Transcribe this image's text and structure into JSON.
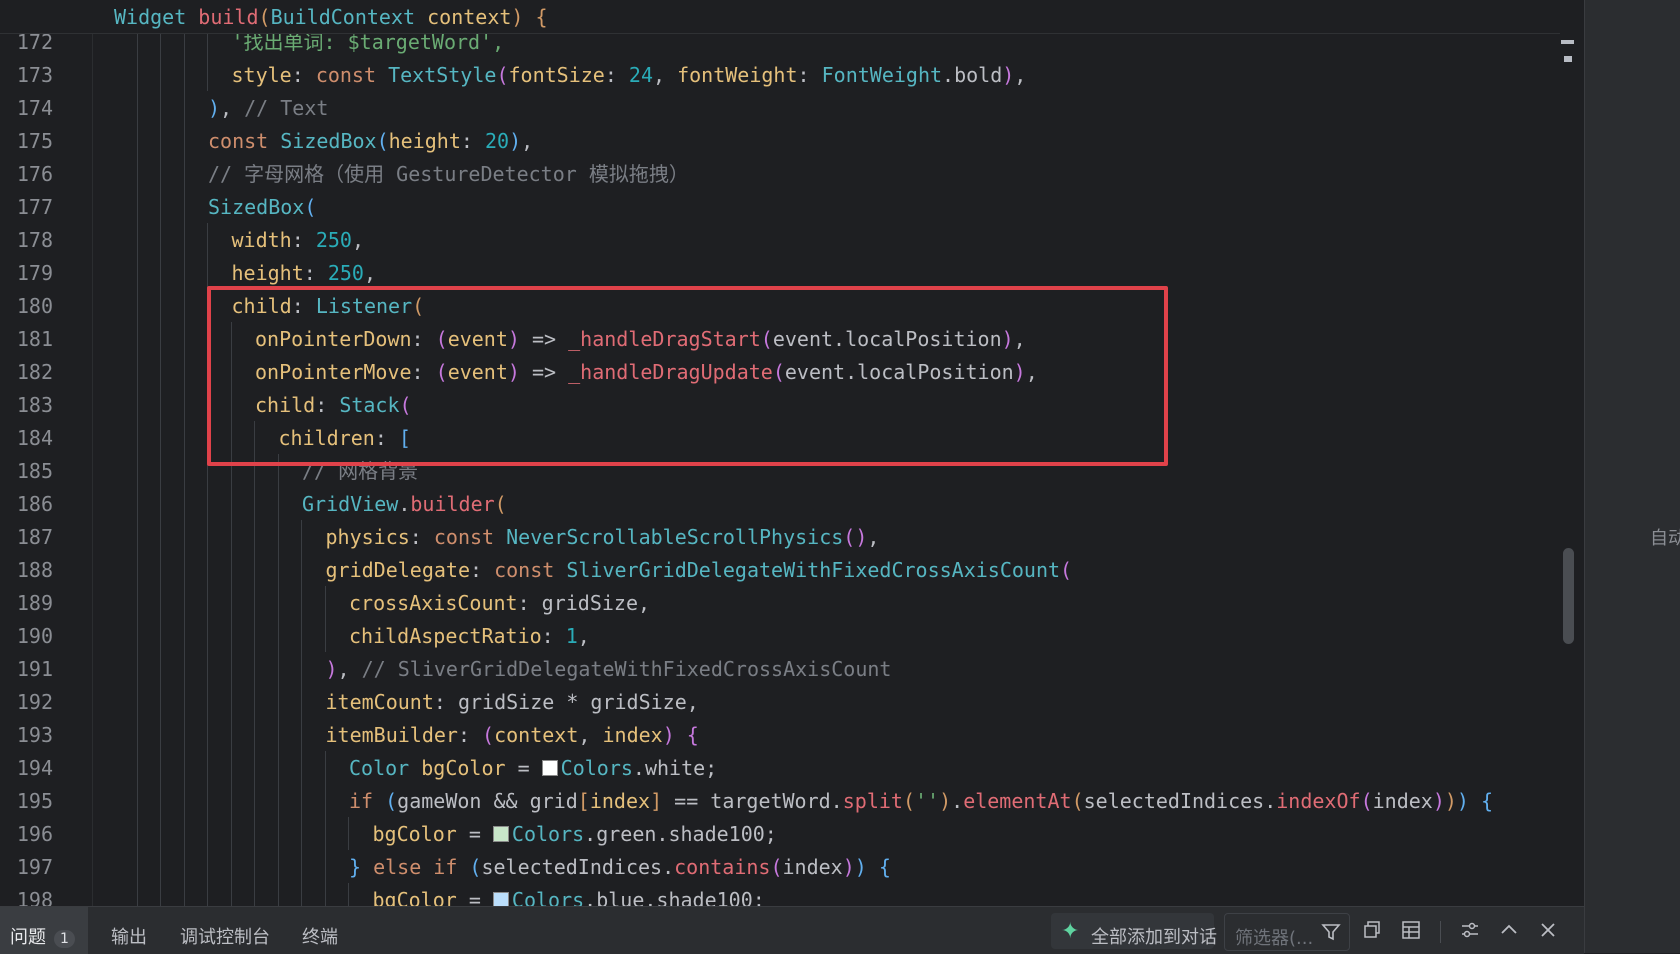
{
  "editor": {
    "sticky_header": "Widget build(BuildContext context) {",
    "lines": [
      {
        "n": "172",
        "indent": 5,
        "tokens": [
          [
            "t-str",
            "'找出单词: $targetWord',"
          ]
        ]
      },
      {
        "n": "173",
        "indent": 5,
        "tokens": [
          [
            "t-param",
            "style"
          ],
          [
            "t-op",
            ": "
          ],
          [
            "t-kw",
            "const "
          ],
          [
            "t-type",
            "TextStyle"
          ],
          [
            "t-br2",
            "("
          ],
          [
            "t-param",
            "fontSize"
          ],
          [
            "t-op",
            ": "
          ],
          [
            "t-num",
            "24"
          ],
          [
            "t-op",
            ", "
          ],
          [
            "t-param",
            "fontWeight"
          ],
          [
            "t-op",
            ": "
          ],
          [
            "t-type",
            "FontWeight"
          ],
          [
            "t-op",
            ".bold"
          ],
          [
            "t-br2",
            ")"
          ],
          [
            "t-op",
            ","
          ]
        ]
      },
      {
        "n": "174",
        "indent": 4,
        "tokens": [
          [
            "t-br3",
            ")"
          ],
          [
            "t-op",
            ", "
          ],
          [
            "t-cm",
            "// Text"
          ]
        ]
      },
      {
        "n": "175",
        "indent": 4,
        "tokens": [
          [
            "t-kw",
            "const "
          ],
          [
            "t-type",
            "SizedBox"
          ],
          [
            "t-br3",
            "("
          ],
          [
            "t-param",
            "height"
          ],
          [
            "t-op",
            ": "
          ],
          [
            "t-num",
            "20"
          ],
          [
            "t-br3",
            ")"
          ],
          [
            "t-op",
            ","
          ]
        ]
      },
      {
        "n": "176",
        "indent": 4,
        "tokens": [
          [
            "t-cm",
            "// 字母网格（使用 GestureDetector 模拟拖拽）"
          ]
        ]
      },
      {
        "n": "177",
        "indent": 4,
        "tokens": [
          [
            "t-type",
            "SizedBox"
          ],
          [
            "t-br3",
            "("
          ]
        ]
      },
      {
        "n": "178",
        "indent": 5,
        "tokens": [
          [
            "t-param",
            "width"
          ],
          [
            "t-op",
            ": "
          ],
          [
            "t-num",
            "250"
          ],
          [
            "t-op",
            ","
          ]
        ]
      },
      {
        "n": "179",
        "indent": 5,
        "tokens": [
          [
            "t-param",
            "height"
          ],
          [
            "t-op",
            ": "
          ],
          [
            "t-num",
            "250"
          ],
          [
            "t-op",
            ","
          ]
        ]
      },
      {
        "n": "180",
        "indent": 5,
        "tokens": [
          [
            "t-param",
            "child"
          ],
          [
            "t-op",
            ": "
          ],
          [
            "t-type",
            "Listener"
          ],
          [
            "t-br1",
            "("
          ]
        ]
      },
      {
        "n": "181",
        "indent": 6,
        "tokens": [
          [
            "t-param",
            "onPointerDown"
          ],
          [
            "t-op",
            ": "
          ],
          [
            "t-br2",
            "("
          ],
          [
            "t-param",
            "event"
          ],
          [
            "t-br2",
            ")"
          ],
          [
            "t-op",
            " => "
          ],
          [
            "t-fn",
            "_handleDragStart"
          ],
          [
            "t-br2",
            "("
          ],
          [
            "t-op",
            "event.localPosition"
          ],
          [
            "t-br2",
            ")"
          ],
          [
            "t-op",
            ","
          ]
        ]
      },
      {
        "n": "182",
        "indent": 6,
        "tokens": [
          [
            "t-param",
            "onPointerMove"
          ],
          [
            "t-op",
            ": "
          ],
          [
            "t-br2",
            "("
          ],
          [
            "t-param",
            "event"
          ],
          [
            "t-br2",
            ")"
          ],
          [
            "t-op",
            " => "
          ],
          [
            "t-fn",
            "_handleDragUpdate"
          ],
          [
            "t-br2",
            "("
          ],
          [
            "t-op",
            "event.localPosition"
          ],
          [
            "t-br2",
            ")"
          ],
          [
            "t-op",
            ","
          ]
        ]
      },
      {
        "n": "183",
        "indent": 6,
        "tokens": [
          [
            "t-param",
            "child"
          ],
          [
            "t-op",
            ": "
          ],
          [
            "t-type",
            "Stack"
          ],
          [
            "t-br2",
            "("
          ]
        ]
      },
      {
        "n": "184",
        "indent": 7,
        "tokens": [
          [
            "t-param",
            "children"
          ],
          [
            "t-op",
            ": "
          ],
          [
            "t-br3",
            "["
          ]
        ]
      },
      {
        "n": "185",
        "indent": 8,
        "tokens": [
          [
            "t-cm",
            "// 网格背景"
          ]
        ]
      },
      {
        "n": "186",
        "indent": 8,
        "tokens": [
          [
            "t-type",
            "GridView"
          ],
          [
            "t-op",
            "."
          ],
          [
            "t-fn",
            "builder"
          ],
          [
            "t-br1",
            "("
          ]
        ]
      },
      {
        "n": "187",
        "indent": 9,
        "tokens": [
          [
            "t-param",
            "physics"
          ],
          [
            "t-op",
            ": "
          ],
          [
            "t-kw",
            "const "
          ],
          [
            "t-type",
            "NeverScrollableScrollPhysics"
          ],
          [
            "t-br2",
            "()"
          ],
          [
            "t-op",
            ","
          ]
        ]
      },
      {
        "n": "188",
        "indent": 9,
        "tokens": [
          [
            "t-param",
            "gridDelegate"
          ],
          [
            "t-op",
            ": "
          ],
          [
            "t-kw",
            "const "
          ],
          [
            "t-type",
            "SliverGridDelegateWithFixedCrossAxisCount"
          ],
          [
            "t-br2",
            "("
          ]
        ]
      },
      {
        "n": "189",
        "indent": 10,
        "tokens": [
          [
            "t-param",
            "crossAxisCount"
          ],
          [
            "t-op",
            ": gridSize,"
          ]
        ]
      },
      {
        "n": "190",
        "indent": 10,
        "tokens": [
          [
            "t-param",
            "childAspectRatio"
          ],
          [
            "t-op",
            ": "
          ],
          [
            "t-num",
            "1"
          ],
          [
            "t-op",
            ","
          ]
        ]
      },
      {
        "n": "191",
        "indent": 9,
        "tokens": [
          [
            "t-br2",
            ")"
          ],
          [
            "t-op",
            ", "
          ],
          [
            "t-cm",
            "// SliverGridDelegateWithFixedCrossAxisCount"
          ]
        ]
      },
      {
        "n": "192",
        "indent": 9,
        "tokens": [
          [
            "t-param",
            "itemCount"
          ],
          [
            "t-op",
            ": gridSize * gridSize,"
          ]
        ]
      },
      {
        "n": "193",
        "indent": 9,
        "tokens": [
          [
            "t-param",
            "itemBuilder"
          ],
          [
            "t-op",
            ": "
          ],
          [
            "t-br2",
            "("
          ],
          [
            "t-param",
            "context"
          ],
          [
            "t-op",
            ", "
          ],
          [
            "t-param",
            "index"
          ],
          [
            "t-br2",
            ")"
          ],
          [
            "t-op",
            " "
          ],
          [
            "t-br2",
            "{"
          ]
        ]
      },
      {
        "n": "194",
        "indent": 10,
        "tokens": [
          [
            "t-type",
            "Color "
          ],
          [
            "t-param",
            "bgColor"
          ],
          [
            "t-op",
            " = "
          ],
          [
            "swatch",
            "#ffffff"
          ],
          [
            "t-type",
            "Colors"
          ],
          [
            "t-op",
            ".white;"
          ]
        ]
      },
      {
        "n": "195",
        "indent": 10,
        "tokens": [
          [
            "t-kw",
            "if "
          ],
          [
            "t-br3",
            "("
          ],
          [
            "t-op",
            "gameWon && grid"
          ],
          [
            "t-br1",
            "["
          ],
          [
            "t-param",
            "index"
          ],
          [
            "t-br1",
            "]"
          ],
          [
            "t-op",
            " == targetWord."
          ],
          [
            "t-fn",
            "split"
          ],
          [
            "t-br1",
            "("
          ],
          [
            "t-str",
            "''"
          ],
          [
            "t-br1",
            ")"
          ],
          [
            "t-op",
            "."
          ],
          [
            "t-fn",
            "elementAt"
          ],
          [
            "t-br1",
            "("
          ],
          [
            "t-op",
            "selectedIndices."
          ],
          [
            "t-fn",
            "indexOf"
          ],
          [
            "t-br2",
            "("
          ],
          [
            "t-op",
            "index"
          ],
          [
            "t-br2",
            ")"
          ],
          [
            "t-br1",
            ")"
          ],
          [
            "t-br3",
            ")"
          ],
          [
            "t-op",
            " "
          ],
          [
            "t-br3",
            "{"
          ]
        ]
      },
      {
        "n": "196",
        "indent": 11,
        "tokens": [
          [
            "t-param",
            "bgColor"
          ],
          [
            "t-op",
            " = "
          ],
          [
            "swatch",
            "#c8e6c9"
          ],
          [
            "t-type",
            "Colors"
          ],
          [
            "t-op",
            ".green.shade100;"
          ]
        ]
      },
      {
        "n": "197",
        "indent": 10,
        "tokens": [
          [
            "t-br3",
            "}"
          ],
          [
            "t-kw",
            " else if "
          ],
          [
            "t-br3",
            "("
          ],
          [
            "t-op",
            "selectedIndices."
          ],
          [
            "t-fn",
            "contains"
          ],
          [
            "t-br2",
            "("
          ],
          [
            "t-op",
            "index"
          ],
          [
            "t-br2",
            ")"
          ],
          [
            "t-br3",
            ")"
          ],
          [
            "t-op",
            " "
          ],
          [
            "t-br3",
            "{"
          ]
        ]
      },
      {
        "n": "198",
        "indent": 11,
        "tokens": [
          [
            "t-param",
            "bgColor"
          ],
          [
            "t-op",
            " = "
          ],
          [
            "swatch",
            "#bbdefb"
          ],
          [
            "t-type",
            "Colors"
          ],
          [
            "t-op",
            ".blue.shade100;"
          ]
        ]
      }
    ]
  },
  "right_pane": {
    "hint": "自动"
  },
  "panel": {
    "tabs": [
      {
        "label": "问题",
        "badge": "1"
      },
      {
        "label": "输出"
      },
      {
        "label": "调试控制台"
      },
      {
        "label": "终端"
      }
    ],
    "ai_button_label": "全部添加到对话",
    "filter_placeholder": "筛选器(..."
  },
  "colors": {
    "highlight_border": "#e0424a",
    "ai_sparkle": "#5fd3a0"
  }
}
